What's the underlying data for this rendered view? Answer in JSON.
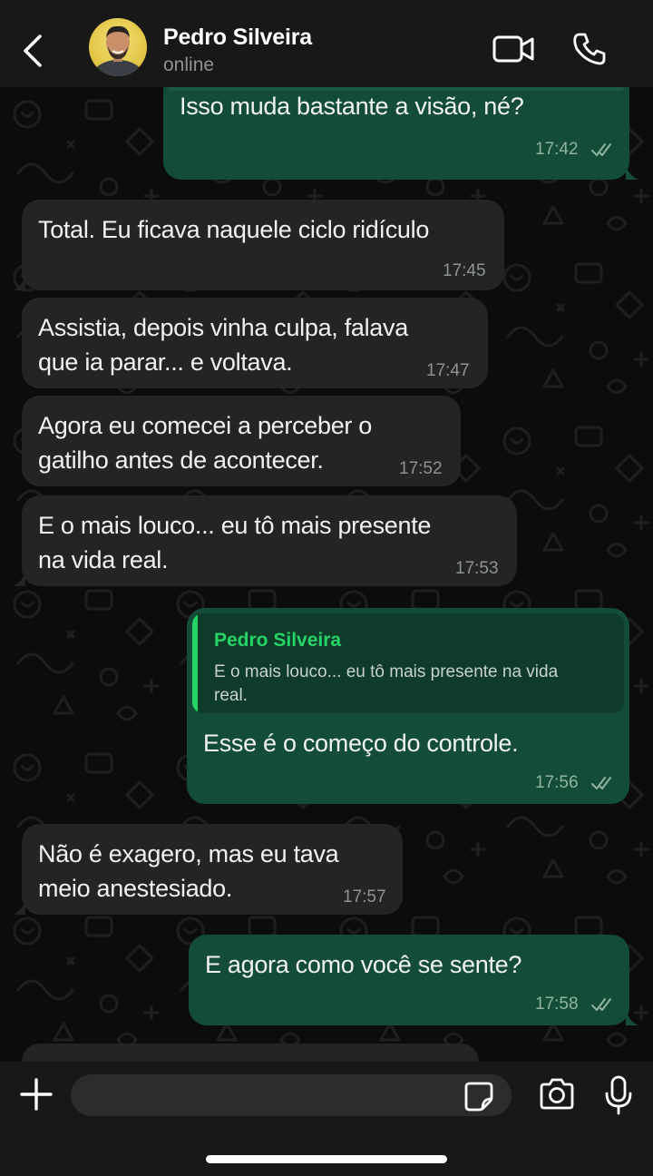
{
  "header": {
    "contact_name": "Pedro Silveira",
    "contact_status": "online",
    "icons": [
      "chevron-left-icon",
      "video-camera-icon",
      "phone-icon"
    ]
  },
  "messages": [
    {
      "direction": "out",
      "text_lines": [
        "Isso muda bastante a visão, né?"
      ],
      "time": "17:42",
      "status": "read"
    },
    {
      "direction": "in",
      "text_lines": [
        "Total. Eu ficava naquele ciclo ridículo"
      ],
      "time": "17:45"
    },
    {
      "direction": "in",
      "text_lines": [
        "Assistia, depois vinha culpa, falava",
        "que ia parar... e voltava."
      ],
      "time": "17:47"
    },
    {
      "direction": "in",
      "text_lines": [
        "Agora eu comecei a perceber o",
        "gatilho antes de acontecer."
      ],
      "time": "17:52"
    },
    {
      "direction": "in",
      "text_lines": [
        "E o mais louco... eu tô mais presente",
        "na vida real."
      ],
      "time": "17:53"
    },
    {
      "direction": "out",
      "quote": {
        "name": "Pedro Silveira",
        "text": "E o mais louco... eu tô mais presente na vida real."
      },
      "text_lines": [
        "Esse é o começo do controle."
      ],
      "time": "17:56",
      "status": "read"
    },
    {
      "direction": "in",
      "text_lines": [
        "Não é exagero, mas eu tava",
        "meio anestesiado."
      ],
      "time": "17:57"
    },
    {
      "direction": "out",
      "text_lines": [
        "E agora como você se sente?"
      ],
      "time": "17:58",
      "status": "read"
    }
  ],
  "composer": {
    "placeholder": "",
    "icons": [
      "plus-icon",
      "sticker-icon",
      "camera-icon",
      "microphone-icon"
    ]
  },
  "colors": {
    "incoming_bubble": "#242424",
    "outgoing_bubble": "#134d37",
    "accent_green": "#25d366",
    "header_bg": "#181818"
  }
}
